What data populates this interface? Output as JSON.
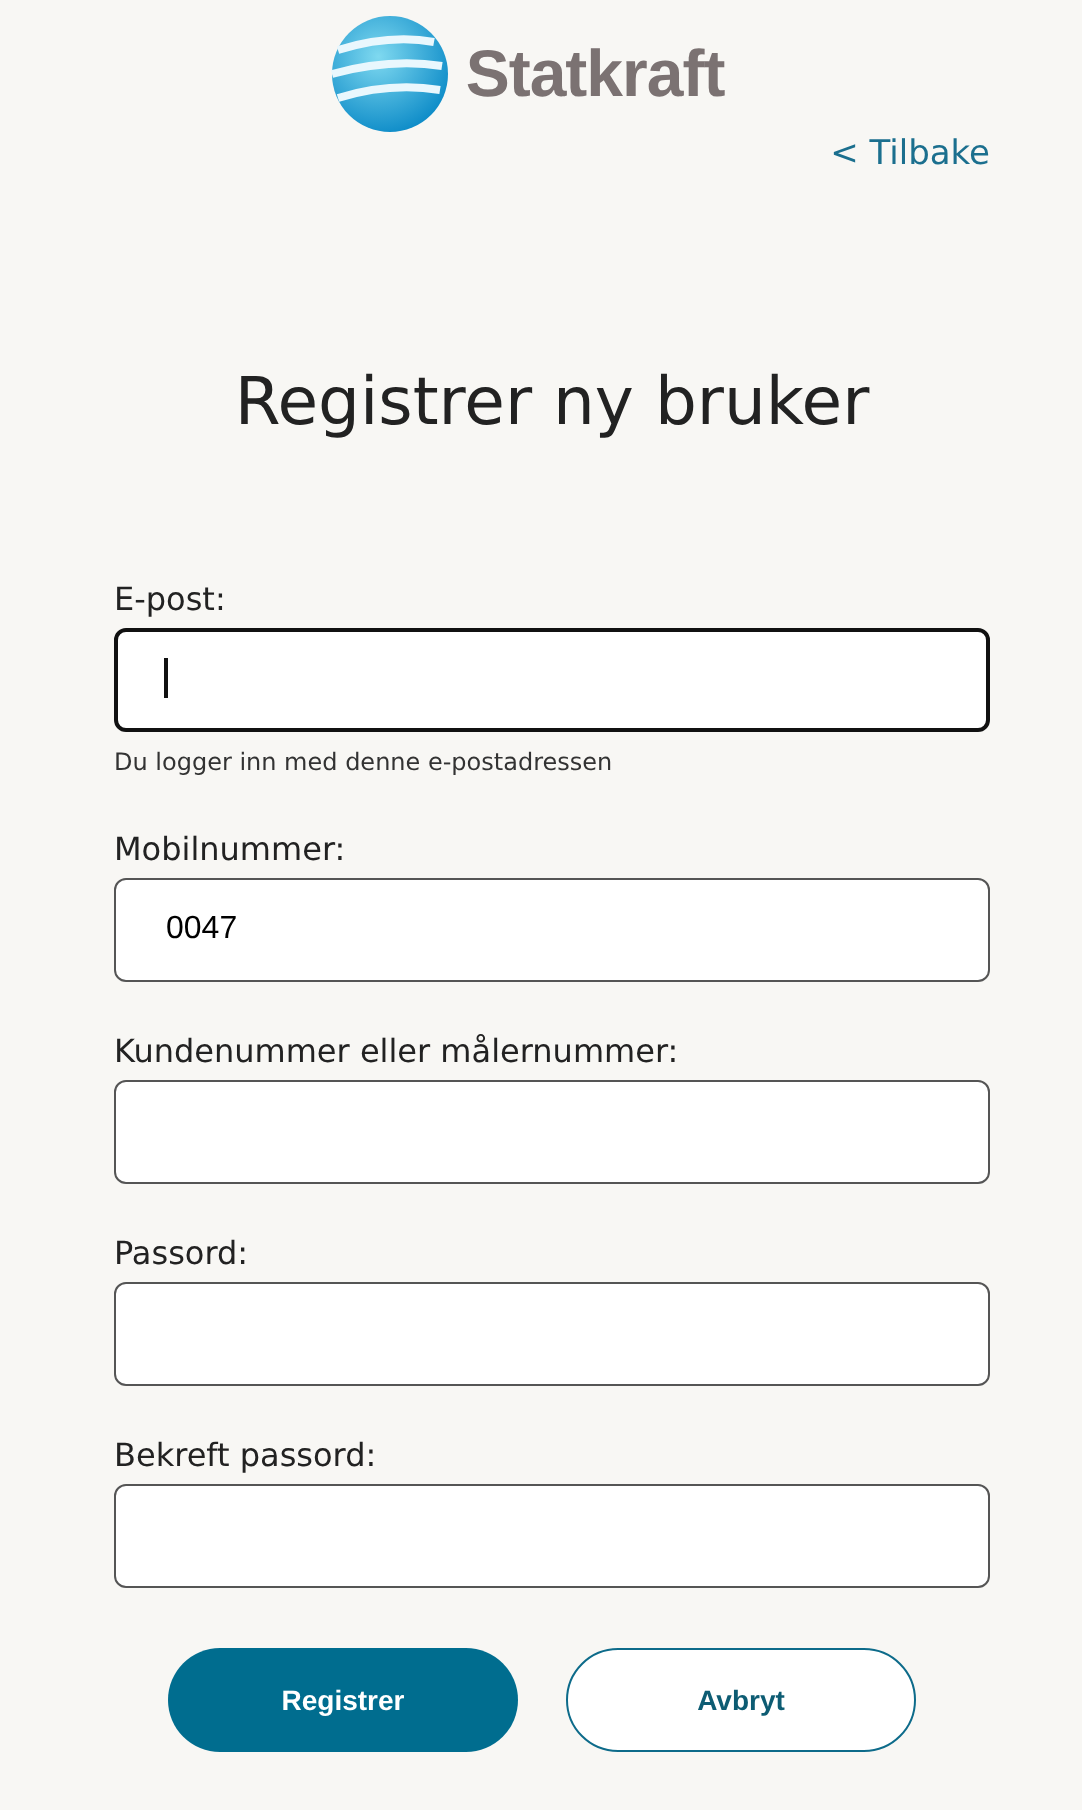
{
  "logo": {
    "text": "Statkraft"
  },
  "back_link": "< Tilbake",
  "title": "Registrer ny bruker",
  "fields": [
    {
      "label": "E-post:",
      "hint": "Du logger inn med denne e-postadressen",
      "focused": true
    },
    {
      "label": "Mobilnummer:",
      "value": "0047",
      "focused": false
    },
    {
      "label": "Kundenummer eller målernummer:",
      "focused": false
    },
    {
      "label": "Passord:",
      "focused": false
    },
    {
      "label": "Bekreft passord:",
      "focused": false
    }
  ],
  "buttons": [
    {
      "label": "Registrer",
      "kind": "primary"
    },
    {
      "label": "Avbryt",
      "kind": "secondary"
    }
  ]
}
